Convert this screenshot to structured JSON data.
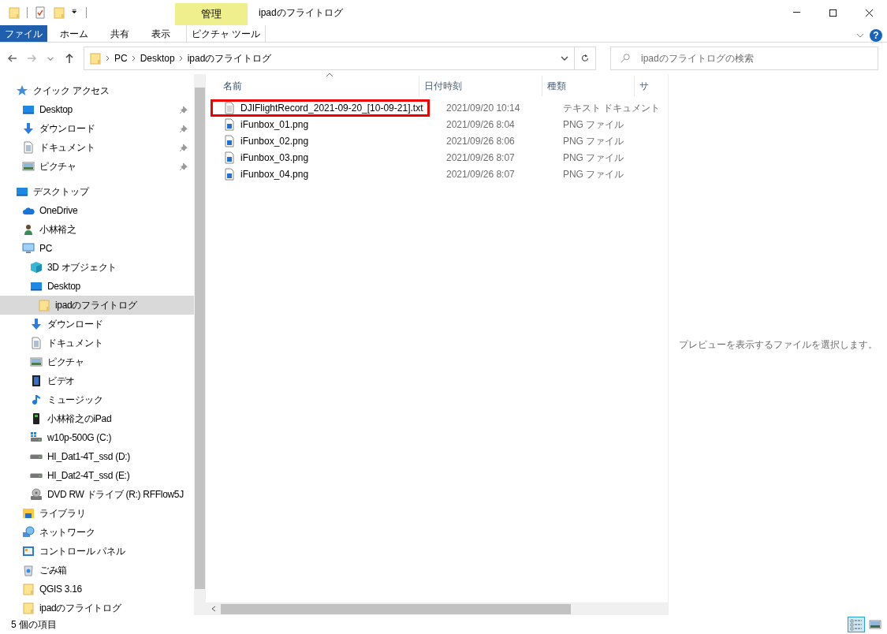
{
  "window": {
    "title": "ipadのフライトログ"
  },
  "ribbon": {
    "context_group": "管理",
    "tabs": [
      {
        "label": "ファイル",
        "kind": "file"
      },
      {
        "label": "ホーム",
        "kind": "plain"
      },
      {
        "label": "共有",
        "kind": "plain"
      },
      {
        "label": "表示",
        "kind": "plain"
      },
      {
        "label": "ピクチャ ツール",
        "kind": "context"
      }
    ],
    "help": "?"
  },
  "address_bar": {
    "crumbs": [
      "PC",
      "Desktop",
      "ipadのフライトログ"
    ]
  },
  "search": {
    "placeholder": "ipadのフライトログの検索"
  },
  "navigation": {
    "items": [
      {
        "label": "クイック アクセス",
        "kind": "star",
        "selected": false,
        "children": [
          {
            "label": "Desktop",
            "kind": "desktop",
            "pinned": true,
            "selected": false
          },
          {
            "label": "ダウンロード",
            "kind": "download",
            "pinned": true,
            "selected": false
          },
          {
            "label": "ドキュメント",
            "kind": "document",
            "pinned": true,
            "selected": false
          },
          {
            "label": "ピクチャ",
            "kind": "picture",
            "pinned": true,
            "selected": false
          }
        ]
      },
      {
        "label": "デスクトップ",
        "kind": "desktop",
        "selected": false,
        "children": [
          {
            "label": "OneDrive",
            "kind": "cloud",
            "selected": false
          },
          {
            "label": "小林裕之",
            "kind": "person",
            "selected": false
          },
          {
            "label": "PC",
            "kind": "pc",
            "selected": false,
            "children": [
              {
                "label": "3D オブジェクト",
                "kind": "cube",
                "selected": false
              },
              {
                "label": "Desktop",
                "kind": "desktop",
                "selected": false,
                "children": [
                  {
                    "label": "ipadのフライトログ",
                    "kind": "folder",
                    "selected": true
                  }
                ]
              },
              {
                "label": "ダウンロード",
                "kind": "download",
                "selected": false
              },
              {
                "label": "ドキュメント",
                "kind": "document",
                "selected": false
              },
              {
                "label": "ピクチャ",
                "kind": "picture",
                "selected": false
              },
              {
                "label": "ビデオ",
                "kind": "film",
                "selected": false
              },
              {
                "label": "ミュージック",
                "kind": "music",
                "selected": false
              },
              {
                "label": "小林裕之のiPad",
                "kind": "phone",
                "selected": false
              },
              {
                "label": "w10p-500G (C:)",
                "kind": "windrive",
                "selected": false
              },
              {
                "label": "HI_Dat1-4T_ssd (D:)",
                "kind": "drive",
                "selected": false
              },
              {
                "label": "HI_Dat2-4T_ssd (E:)",
                "kind": "drive",
                "selected": false
              },
              {
                "label": "DVD RW ドライブ (R:) RFFlow5J",
                "kind": "disc",
                "selected": false
              }
            ]
          },
          {
            "label": "ライブラリ",
            "kind": "library",
            "selected": false
          },
          {
            "label": "ネットワーク",
            "kind": "network",
            "selected": false
          },
          {
            "label": "コントロール パネル",
            "kind": "control",
            "selected": false
          },
          {
            "label": "ごみ箱",
            "kind": "trash",
            "selected": false
          },
          {
            "label": "QGIS 3.16",
            "kind": "folder",
            "selected": false
          },
          {
            "label": "ipadのフライトログ",
            "kind": "folder",
            "selected": false
          }
        ]
      }
    ]
  },
  "file_list": {
    "columns": [
      {
        "label": "名前",
        "sorted": true
      },
      {
        "label": "日付時刻",
        "sorted": false
      },
      {
        "label": "種類",
        "sorted": false
      },
      {
        "label": "サ",
        "sorted": false
      }
    ],
    "rows": [
      {
        "name": "DJIFlightRecord_2021-09-20_[10-09-21].txt",
        "date": "2021/09/20 10:14",
        "type": "テキスト ドキュメント",
        "kind": "text",
        "highlighted": true
      },
      {
        "name": "iFunbox_01.png",
        "date": "2021/09/26 8:04",
        "type": "PNG ファイル",
        "kind": "image",
        "highlighted": false
      },
      {
        "name": "iFunbox_02.png",
        "date": "2021/09/26 8:06",
        "type": "PNG ファイル",
        "kind": "image",
        "highlighted": false
      },
      {
        "name": "iFunbox_03.png",
        "date": "2021/09/26 8:07",
        "type": "PNG ファイル",
        "kind": "image",
        "highlighted": false
      },
      {
        "name": "iFunbox_04.png",
        "date": "2021/09/26 8:07",
        "type": "PNG ファイル",
        "kind": "image",
        "highlighted": false
      }
    ]
  },
  "preview": {
    "message": "プレビューを表示するファイルを選択します。"
  },
  "status_bar": {
    "count": "5 個の項目",
    "views": [
      {
        "kind": "details",
        "selected": true
      },
      {
        "kind": "thumbnails",
        "selected": false
      }
    ]
  }
}
